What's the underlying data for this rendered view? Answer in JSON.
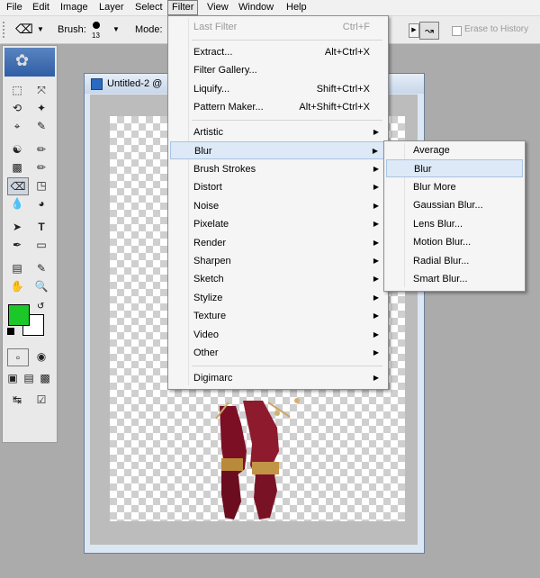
{
  "menubar": {
    "items": [
      "File",
      "Edit",
      "Image",
      "Layer",
      "Select",
      "Filter",
      "View",
      "Window",
      "Help"
    ],
    "active": "Filter"
  },
  "options": {
    "brush_label": "Brush:",
    "brush_size": "13",
    "mode_label": "Mode:",
    "erase_history_label": "Erase to History",
    "erase_history_checked": false
  },
  "toolbox": {
    "foreground_color": "#1cc829",
    "background_color": "#ffffff",
    "selected_tool": "eraser-tool"
  },
  "document": {
    "title": "Untitled-2 @"
  },
  "filter_menu": {
    "last_filter": {
      "label": "Last Filter",
      "shortcut": "Ctrl+F"
    },
    "group1": [
      {
        "label": "Extract...",
        "shortcut": "Alt+Ctrl+X"
      },
      {
        "label": "Filter Gallery...",
        "shortcut": ""
      },
      {
        "label": "Liquify...",
        "shortcut": "Shift+Ctrl+X"
      },
      {
        "label": "Pattern Maker...",
        "shortcut": "Alt+Shift+Ctrl+X"
      }
    ],
    "submenus": [
      "Artistic",
      "Blur",
      "Brush Strokes",
      "Distort",
      "Noise",
      "Pixelate",
      "Render",
      "Sharpen",
      "Sketch",
      "Stylize",
      "Texture",
      "Video",
      "Other"
    ],
    "highlighted": "Blur",
    "last": "Digimarc"
  },
  "blur_submenu": {
    "items": [
      "Average",
      "Blur",
      "Blur More",
      "Gaussian Blur...",
      "Lens Blur...",
      "Motion Blur...",
      "Radial Blur...",
      "Smart Blur..."
    ],
    "highlighted": "Blur"
  }
}
